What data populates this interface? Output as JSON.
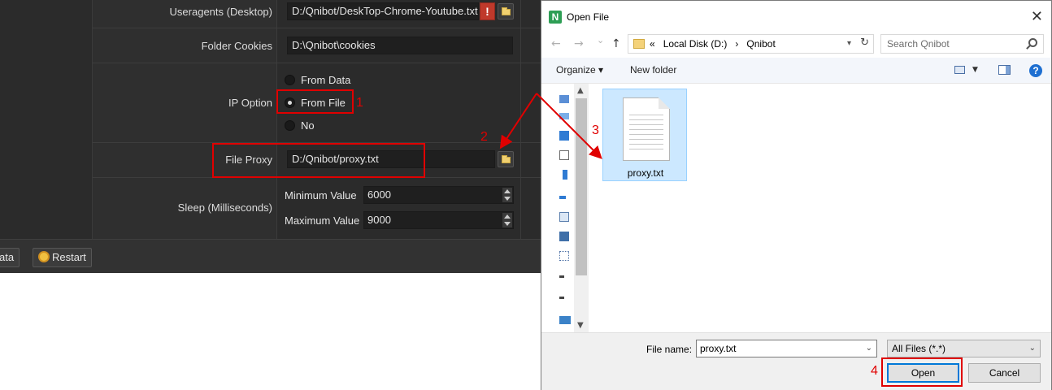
{
  "app": {
    "rows": {
      "useragents": {
        "label": "Useragents (Desktop)",
        "value": "D:/Qnibot/DeskTop-Chrome-Youtube.txt",
        "warn": "!"
      },
      "cookies": {
        "label": "Folder Cookies",
        "value": "D:\\Qnibot\\cookies"
      },
      "ip": {
        "label": "IP Option",
        "options": [
          "From Data",
          "From File",
          "No"
        ],
        "selected": "From File"
      },
      "proxy": {
        "label": "File Proxy",
        "value": "D:/Qnibot/proxy.txt"
      },
      "sleep": {
        "label": "Sleep (Milliseconds)",
        "min_label": "Minimum Value",
        "min_value": "6000",
        "max_label": "Maximum Value",
        "max_value": "9000"
      }
    },
    "bottom": {
      "data_btn": "ata",
      "restart_btn": "Restart"
    }
  },
  "annotations": [
    "1",
    "2",
    "3",
    "4"
  ],
  "dialog": {
    "title": "Open File",
    "close": "✕",
    "nav": {
      "back": "←",
      "forward": "→",
      "recent": "⌄",
      "up": "↑"
    },
    "breadcrumb": [
      "«",
      "Local Disk (D:)",
      "›",
      "Qnibot"
    ],
    "search_placeholder": "Search Qnibot",
    "toolbar": {
      "organize": "Organize ▾",
      "new_folder": "New folder",
      "help": "?"
    },
    "files": [
      {
        "name": "proxy.txt"
      }
    ],
    "footer": {
      "filename_label": "File name:",
      "filename_value": "proxy.txt",
      "filetype": "All Files (*.*)",
      "open": "Open",
      "cancel": "Cancel"
    }
  },
  "colors": {
    "annotation": "#e00000",
    "app_bg": "#2b2b2b",
    "selection": "#cce8ff",
    "help": "#1e6fd1"
  }
}
